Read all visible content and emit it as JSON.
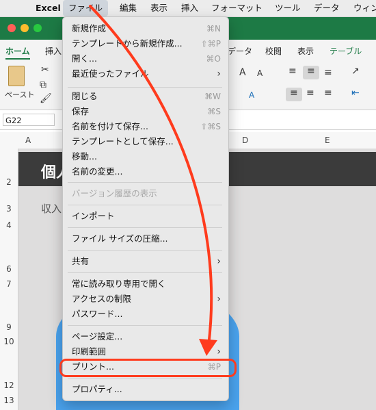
{
  "menubar": {
    "apple": "",
    "items": [
      "Excel",
      "ファイル",
      "編集",
      "表示",
      "挿入",
      "フォーマット",
      "ツール",
      "データ",
      "ウィン"
    ]
  },
  "ribbon": {
    "tabs": [
      "ホーム",
      "挿入",
      "データ",
      "校閲",
      "表示",
      "テーブル"
    ],
    "paste_label": "ペースト"
  },
  "formula_bar": {
    "cell_ref": "G22"
  },
  "grid": {
    "columns": [
      "A",
      "D",
      "E"
    ],
    "rows": [
      "2",
      "3",
      "4",
      "6",
      "7",
      "9",
      "10",
      "12",
      "13"
    ],
    "banner_text": "個人",
    "cell_text": "収入"
  },
  "file_menu": {
    "items": [
      {
        "label": "新規作成",
        "shortcut": "⌘N"
      },
      {
        "label": "テンプレートから新規作成...",
        "shortcut": "⇧⌘P"
      },
      {
        "label": "開く...",
        "shortcut": "⌘O"
      },
      {
        "label": "最近使ったファイル",
        "submenu": true
      },
      {
        "label": "閉じる",
        "shortcut": "⌘W"
      },
      {
        "label": "保存",
        "shortcut": "⌘S"
      },
      {
        "label": "名前を付けて保存...",
        "shortcut": "⇧⌘S"
      },
      {
        "label": "テンプレートとして保存..."
      },
      {
        "label": "移動..."
      },
      {
        "label": "名前の変更..."
      },
      {
        "label": "バージョン履歴の表示",
        "disabled": true
      },
      {
        "label": "インポート"
      },
      {
        "label": "ファイル サイズの圧縮..."
      },
      {
        "label": "共有",
        "submenu": true
      },
      {
        "label": "常に読み取り専用で開く"
      },
      {
        "label": "アクセスの制限",
        "submenu": true
      },
      {
        "label": "パスワード..."
      },
      {
        "label": "ページ設定..."
      },
      {
        "label": "印刷範囲",
        "submenu": true
      },
      {
        "label": "プリント...",
        "shortcut": "⌘P"
      },
      {
        "label": "プロパティ..."
      }
    ]
  },
  "colors": {
    "accent_annotation": "#ff3b1d",
    "excel_green": "#1d7a45"
  }
}
